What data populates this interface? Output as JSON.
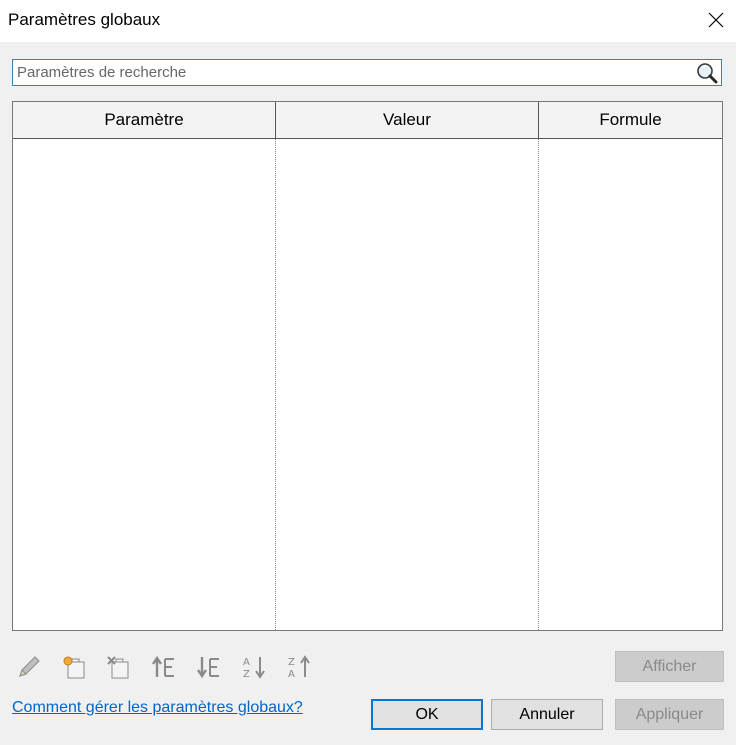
{
  "window": {
    "title": "Paramètres globaux",
    "close_icon": "close-icon"
  },
  "search": {
    "placeholder": "Paramètres de recherche",
    "value": "",
    "icon": "search-magnifier-icon"
  },
  "grid": {
    "columns": [
      "Paramètre",
      "Valeur",
      "Formule"
    ],
    "rows": []
  },
  "toolbar": {
    "icons": [
      "edit-pencil-icon",
      "new-parameter-icon",
      "delete-parameter-icon",
      "move-up-icon",
      "move-down-icon",
      "sort-ascending-icon",
      "sort-descending-icon"
    ]
  },
  "buttons": {
    "afficher": "Afficher",
    "ok": "OK",
    "annuler": "Annuler",
    "appliquer": "Appliquer"
  },
  "help_link": "Comment gérer les paramètres globaux?",
  "colors": {
    "accent": "#0078d7",
    "link": "#0066cc",
    "search_border": "#3c7fb1"
  }
}
